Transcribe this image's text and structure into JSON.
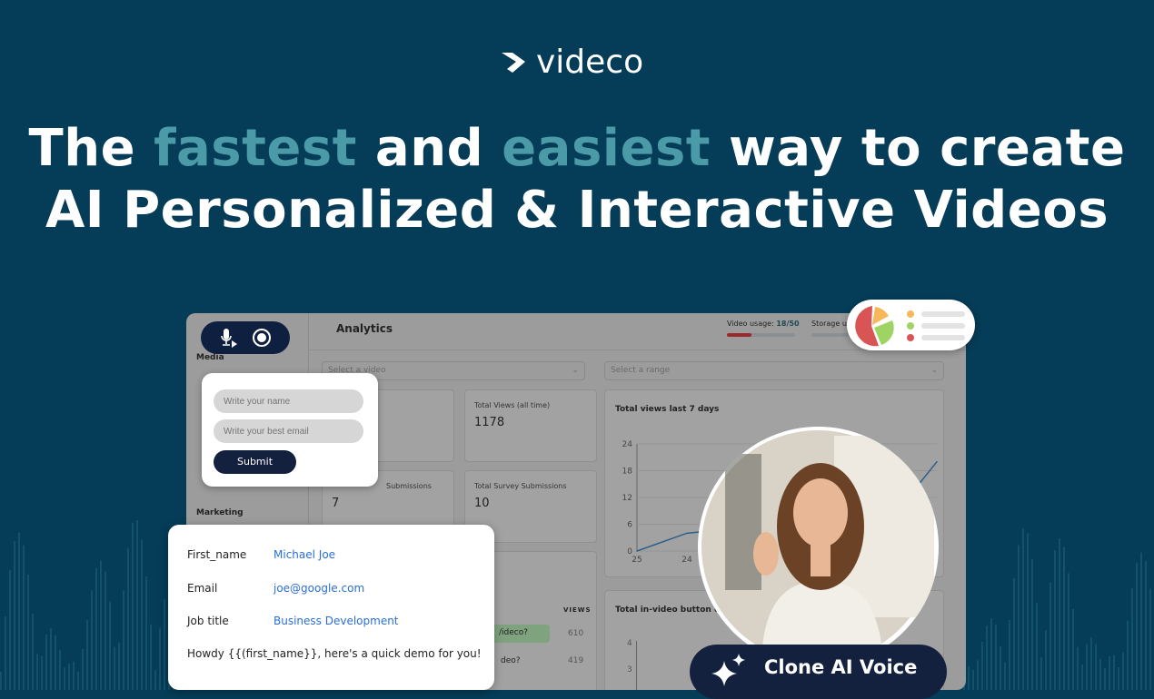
{
  "brand": {
    "name": "videco"
  },
  "headline": {
    "line1_a": "The ",
    "line1_fast": "fastest",
    "line1_b": " and ",
    "line1_easy": "easiest",
    "line1_c": " way to create",
    "line2": "AI Personalized & Interactive Videos"
  },
  "colors": {
    "background": "#053c57",
    "highlight": "#4b9aa8",
    "navy": "#13213f",
    "link": "#2b6fd6"
  },
  "dashboard": {
    "title": "Analytics",
    "sidebar": {
      "sections": [
        "Media",
        "Marketing"
      ]
    },
    "usage": {
      "video_label": "Video usage:",
      "video_value": "18/50",
      "video_fraction": 0.36,
      "storage_label": "Storage us"
    },
    "select_video": "Select a video",
    "select_range": "Select a range",
    "cards": [
      {
        "label": "Total Views (all time)",
        "value": "1178"
      },
      {
        "label": "Submissions",
        "value": "7"
      },
      {
        "label": "Total Survey Submissions",
        "value": "10"
      }
    ],
    "table": {
      "header": "VIEWS",
      "rows": [
        {
          "label": "/ideco?",
          "views": "610"
        },
        {
          "label": "deo?",
          "views": "419"
        }
      ]
    },
    "chart1": {
      "title": "Total views last 7 days"
    },
    "chart2": {
      "title": "Total in-video button cl"
    }
  },
  "chart_data": [
    {
      "type": "line",
      "title": "Total views last 7 days",
      "ylim": [
        0,
        24
      ],
      "yticks": [
        "0",
        "6",
        "12",
        "18",
        "24"
      ],
      "xticks": [
        "25",
        "24"
      ],
      "x": [
        0,
        1,
        2,
        3,
        4,
        5,
        6
      ],
      "values": [
        0,
        4,
        5,
        4,
        3,
        6,
        20
      ]
    },
    {
      "type": "bar",
      "title": "Total in-video button cl",
      "yticks": [
        "3",
        "4"
      ]
    }
  ],
  "form": {
    "name_placeholder": "Write your name",
    "email_placeholder": "Write your best email",
    "submit": "Submit"
  },
  "record_pill": {
    "icons": [
      "mic-play-icon",
      "record-icon"
    ]
  },
  "info_card": {
    "rows": [
      {
        "label": "First_name",
        "value": "Michael Joe"
      },
      {
        "label": "Email",
        "value": "joe@google.com"
      },
      {
        "label": "Job title",
        "value": "Business Development"
      }
    ],
    "message": "Howdy {{(first_name}}, here's a quick demo for you!"
  },
  "voice_button": {
    "label": "Clone AI Voice"
  }
}
